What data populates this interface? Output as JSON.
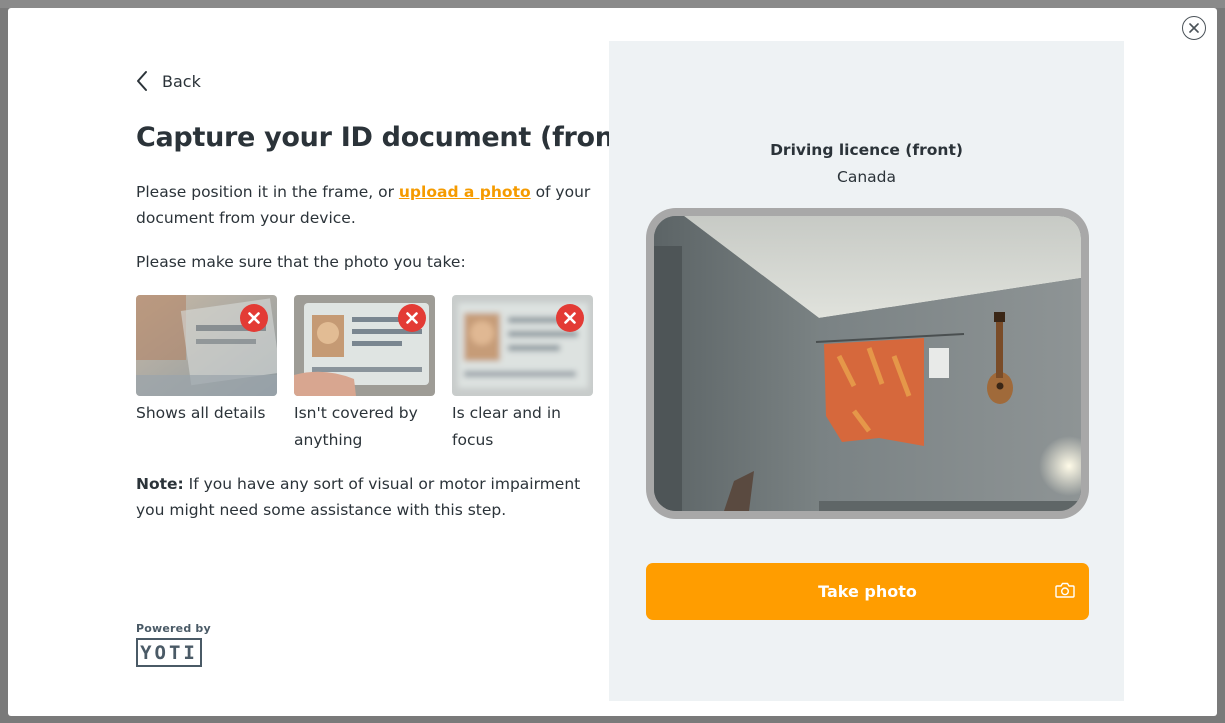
{
  "modal": {
    "close_icon": "close-icon"
  },
  "left": {
    "back_label": "Back",
    "title": "Capture your ID document (front)",
    "intro_before": "Please position it in the frame, or ",
    "intro_link": "upload a photo",
    "intro_after": " of your document from your device.",
    "make_sure": "Please make sure that the photo you take:",
    "examples": [
      {
        "caption": "Shows all details",
        "icon": "x-icon"
      },
      {
        "caption": "Isn't covered by anything",
        "icon": "x-icon"
      },
      {
        "caption": "Is clear and in focus",
        "icon": "x-icon"
      }
    ],
    "note_label": "Note:",
    "note_text": " If you have any sort of visual or motor impairment you might need some assistance with this step.",
    "powered_by": "Powered by",
    "logo_text": "YOTI"
  },
  "right": {
    "doc_type": "Driving licence (front)",
    "country": "Canada",
    "take_photo_label": "Take photo",
    "camera_icon": "camera-icon"
  },
  "colors": {
    "accent": "#ff9d00",
    "link": "#f59b00",
    "error": "#e33b35",
    "panel_bg": "#eef2f4",
    "text": "#2b3339"
  }
}
